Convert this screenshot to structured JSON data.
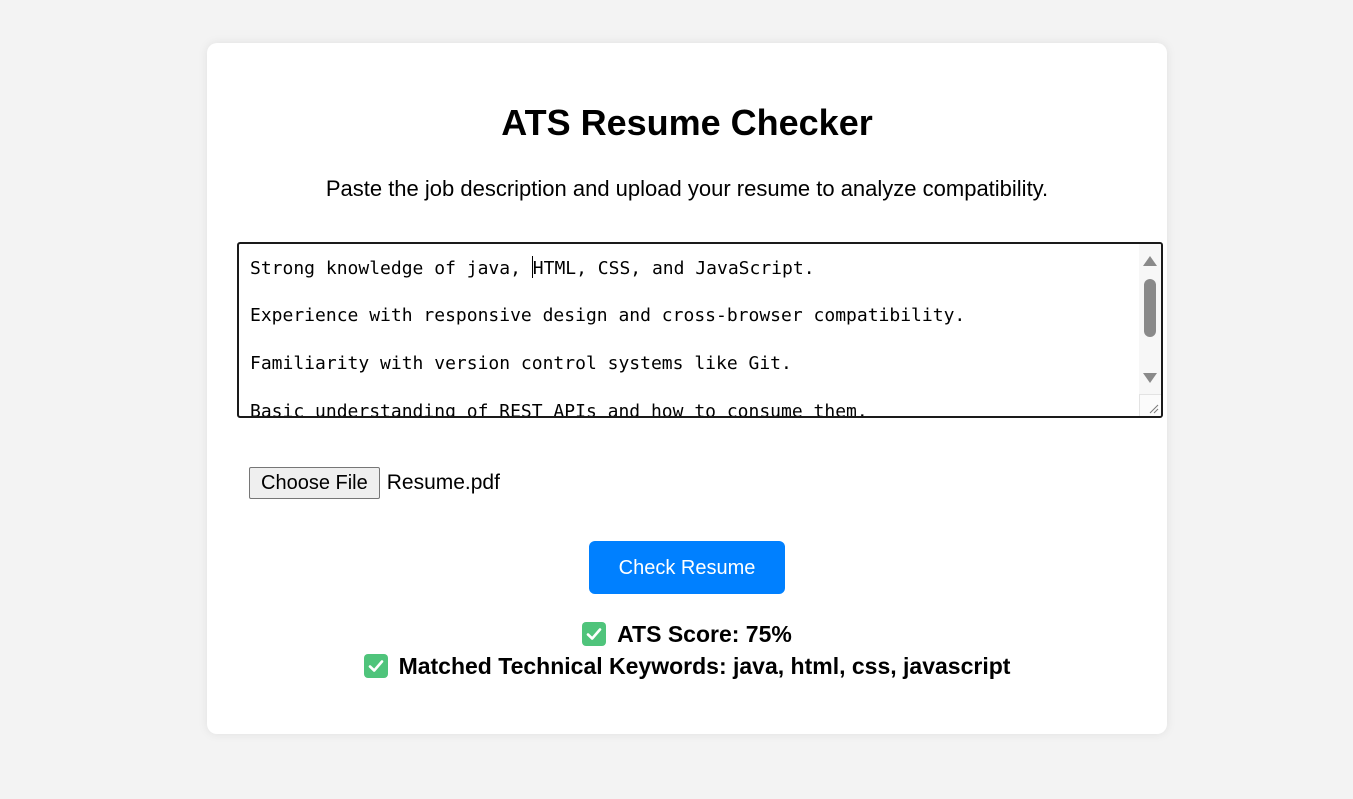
{
  "app": {
    "title": "ATS Resume Checker",
    "subtitle": "Paste the job description and upload your resume to analyze compatibility."
  },
  "job_description": {
    "lines": [
      "Strong knowledge of java, HTML, CSS, and JavaScript.",
      "Experience with responsive design and cross-browser compatibility.",
      "Familiarity with version control systems like Git.",
      "Basic understanding of REST APIs and how to consume them."
    ],
    "caret_after": "Strong knowledge of java, ",
    "caret_before": "HTML, CSS, and JavaScript."
  },
  "file_upload": {
    "button_label": "Choose File",
    "file_name": "Resume.pdf"
  },
  "check_button": {
    "label": "Check Resume",
    "color": "#0080ff"
  },
  "results": {
    "score_text": "ATS Score: 75%",
    "keywords_text": "Matched Technical Keywords: java, html, css, javascript",
    "icon": "check-mark-button-icon",
    "icon_color": "#4fc47b"
  },
  "colors": {
    "page_background": "#f3f3f3",
    "card_background": "#ffffff"
  }
}
